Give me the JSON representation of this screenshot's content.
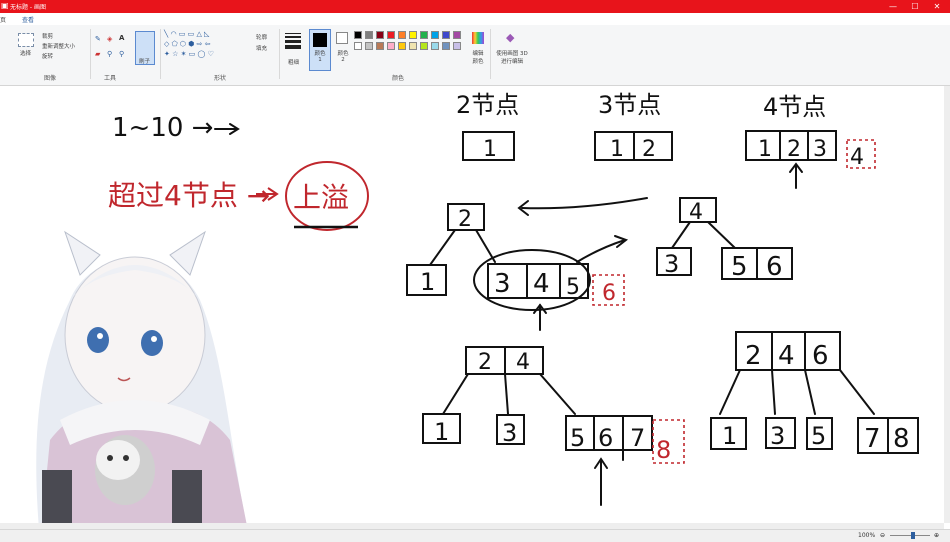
{
  "window": {
    "title": "无标题 - 画图",
    "minimize": "—",
    "maximize": "☐",
    "close": "✕"
  },
  "menu": {
    "file": "页",
    "view": "查看"
  },
  "ribbon": {
    "image_group": {
      "label": "图像",
      "select": "选择",
      "crop": "裁剪",
      "resize": "重新调整大小",
      "rotate": "旋转"
    },
    "tools_group": {
      "label": "工具",
      "brush": "刷子"
    },
    "shapes_group": {
      "label": "形状",
      "outline": "轮廓",
      "fill": "填充"
    },
    "size": "粗细",
    "color1": "颜色 1",
    "color2": "颜色 2",
    "colors_group": {
      "label": "颜色"
    },
    "edit_colors": "编辑颜色",
    "paint3d": "使用画图 3D 进行编辑",
    "palette": [
      "#000000",
      "#7f7f7f",
      "#880015",
      "#ed1c24",
      "#ff7f27",
      "#fff200",
      "#22b14c",
      "#00a2e8",
      "#3f48cc",
      "#a349a4",
      "#ffffff",
      "#c3c3c3",
      "#b97a57",
      "#ffaec9",
      "#ffc90e",
      "#efe4b0",
      "#b5e61d",
      "#99d9ea",
      "#7092be",
      "#c8bfe7"
    ]
  },
  "canvas": {
    "range_text": "1~10 →",
    "overflow_text": "超过4节点 →",
    "overflow_result": "上溢",
    "header_2": "2节点",
    "header_3": "3节点",
    "header_4": "4节点",
    "box_2node": "1",
    "box_3node": [
      "1",
      "2"
    ],
    "box_4node": [
      "1",
      "2",
      "3"
    ],
    "insert_4": "4",
    "mid_left_parent": "2",
    "mid_left_child1": "1",
    "mid_left_child2": [
      "3",
      "4",
      "5"
    ],
    "mid_left_insert": "6",
    "mid_right_parent": "4",
    "mid_right_child1": "3",
    "mid_right_child2": [
      "5",
      "6"
    ],
    "bot_left_parent": [
      "2",
      "4"
    ],
    "bot_left_child1": "1",
    "bot_left_child2": "3",
    "bot_left_child3": [
      "5",
      "6",
      "7"
    ],
    "bot_left_insert": "8",
    "bot_right_parent": [
      "2",
      "4",
      "6"
    ],
    "bot_right_child1": "1",
    "bot_right_child2": "3",
    "bot_right_child3": "5",
    "bot_right_child4": [
      "7",
      "8"
    ]
  },
  "status": {
    "zoom": "100%"
  },
  "colors": {
    "titlebar": "#e8141b",
    "ink": "#111111",
    "red_ink": "#c0272d",
    "accent": "#2d5e9e"
  }
}
